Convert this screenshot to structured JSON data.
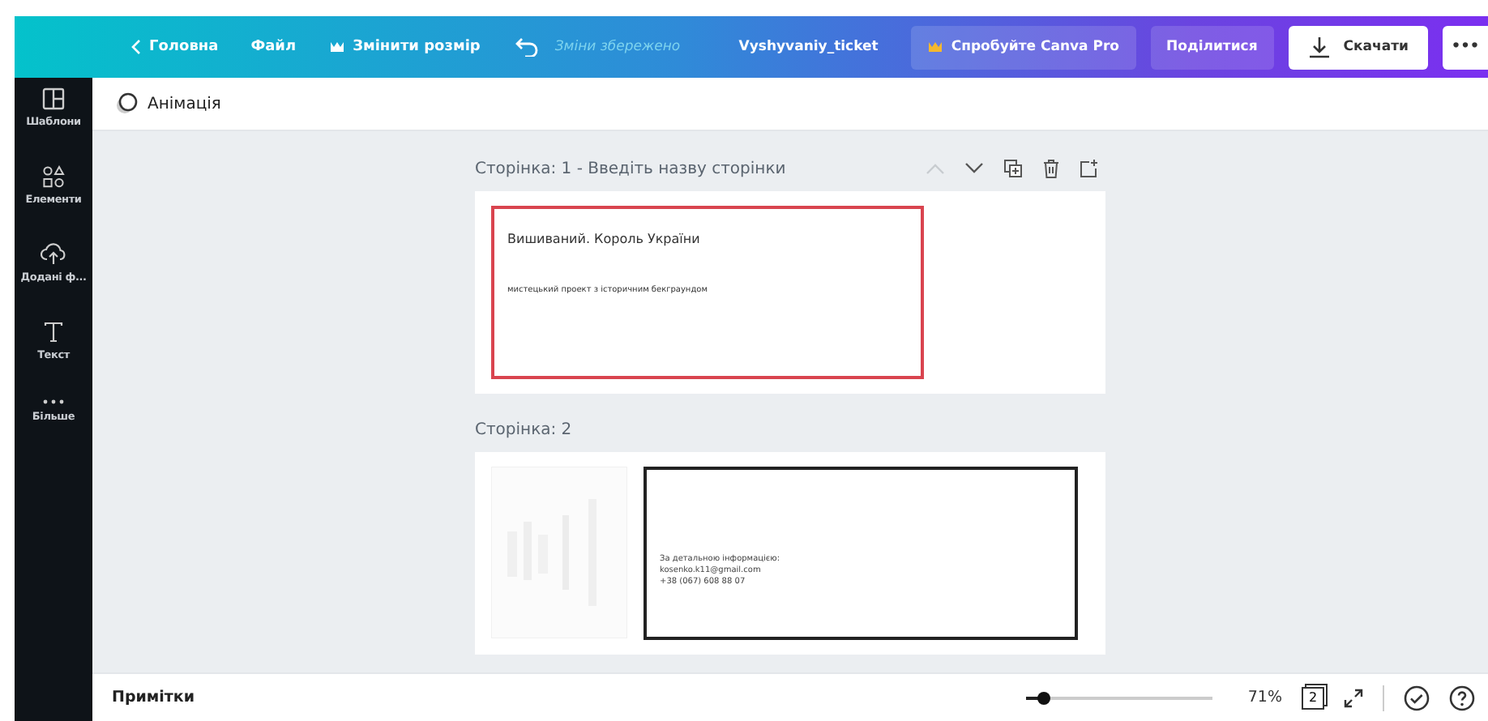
{
  "header": {
    "back": "Головна",
    "file": "Файл",
    "resize": "Змінити розмір",
    "saved": "Зміни збережено",
    "title": "Vyshyvaniy_ticket",
    "pro": "Спробуйте Canva Pro",
    "share": "Поділитися",
    "download": "Скачати",
    "more": "•••"
  },
  "sidebar": {
    "items": [
      {
        "kind": "templates",
        "label": "Шаблони"
      },
      {
        "kind": "elements",
        "label": "Елементи"
      },
      {
        "kind": "uploads",
        "label": "Додані ф..."
      },
      {
        "kind": "text",
        "label": "Текст"
      },
      {
        "kind": "more",
        "label": "Більше"
      }
    ]
  },
  "toolbar": {
    "animation": "Анімація"
  },
  "pages": [
    {
      "title": "Сторінка: 1 - Введіть назву сторінки",
      "show_actions": true,
      "kind": "accent",
      "has_picture": false,
      "texts": [
        {
          "kind": "heading",
          "text": "Вишиваний. Король України"
        },
        {
          "kind": "small",
          "text": "мистецький проект з історичним бекграундом"
        }
      ]
    },
    {
      "title": "Сторінка: 2",
      "show_actions": false,
      "kind": "plain",
      "has_picture": true,
      "texts": [
        {
          "kind": "tiny",
          "text": "За детальною інформацією:"
        },
        {
          "kind": "tiny",
          "text": "kosenko.k11@gmail.com"
        },
        {
          "kind": "tiny",
          "text": "+38 (067) 608 88 07"
        }
      ]
    }
  ],
  "footer": {
    "notes": "Примітки",
    "zoom": {
      "level": 0.1
    },
    "zoom_reading": "71%",
    "page_count": "2"
  }
}
